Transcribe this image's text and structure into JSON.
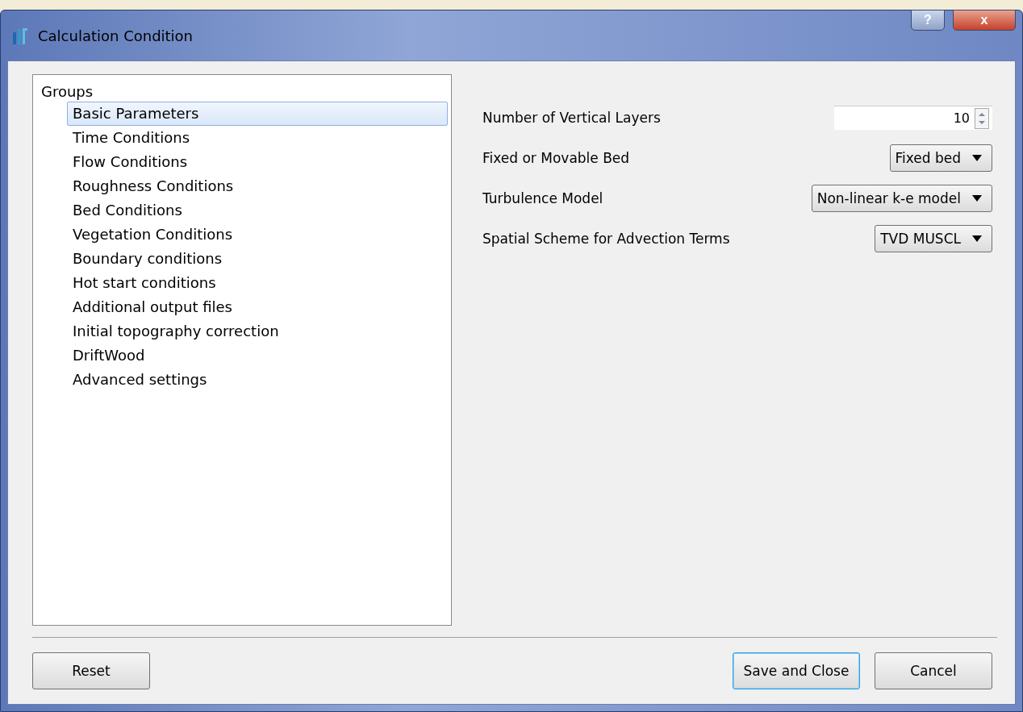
{
  "window": {
    "title": "Calculation Condition",
    "help_button": "?",
    "close_button": "x"
  },
  "groups": {
    "title": "Groups",
    "items": [
      {
        "label": "Basic Parameters",
        "selected": true
      },
      {
        "label": "Time Conditions",
        "selected": false
      },
      {
        "label": "Flow Conditions",
        "selected": false
      },
      {
        "label": "Roughness Conditions",
        "selected": false
      },
      {
        "label": "Bed Conditions",
        "selected": false
      },
      {
        "label": "Vegetation Conditions",
        "selected": false
      },
      {
        "label": "Boundary conditions",
        "selected": false
      },
      {
        "label": "Hot start conditions",
        "selected": false
      },
      {
        "label": "Additional output files",
        "selected": false
      },
      {
        "label": "Initial topography correction",
        "selected": false
      },
      {
        "label": "DriftWood",
        "selected": false
      },
      {
        "label": "Advanced settings",
        "selected": false
      }
    ]
  },
  "fields": [
    {
      "kind": "spin",
      "label": "Number of Vertical Layers",
      "value": "10"
    },
    {
      "kind": "combo",
      "label": "Fixed or Movable Bed",
      "value": "Fixed bed"
    },
    {
      "kind": "combo",
      "label": "Turbulence Model",
      "value": "Non-linear k-e model"
    },
    {
      "kind": "combo",
      "label": "Spatial Scheme for Advection Terms",
      "value": "TVD MUSCL"
    }
  ],
  "buttons": {
    "left": [
      "Reset"
    ],
    "right": [
      {
        "label": "Save and Close",
        "default": true
      },
      {
        "label": "Cancel",
        "default": false
      }
    ]
  }
}
